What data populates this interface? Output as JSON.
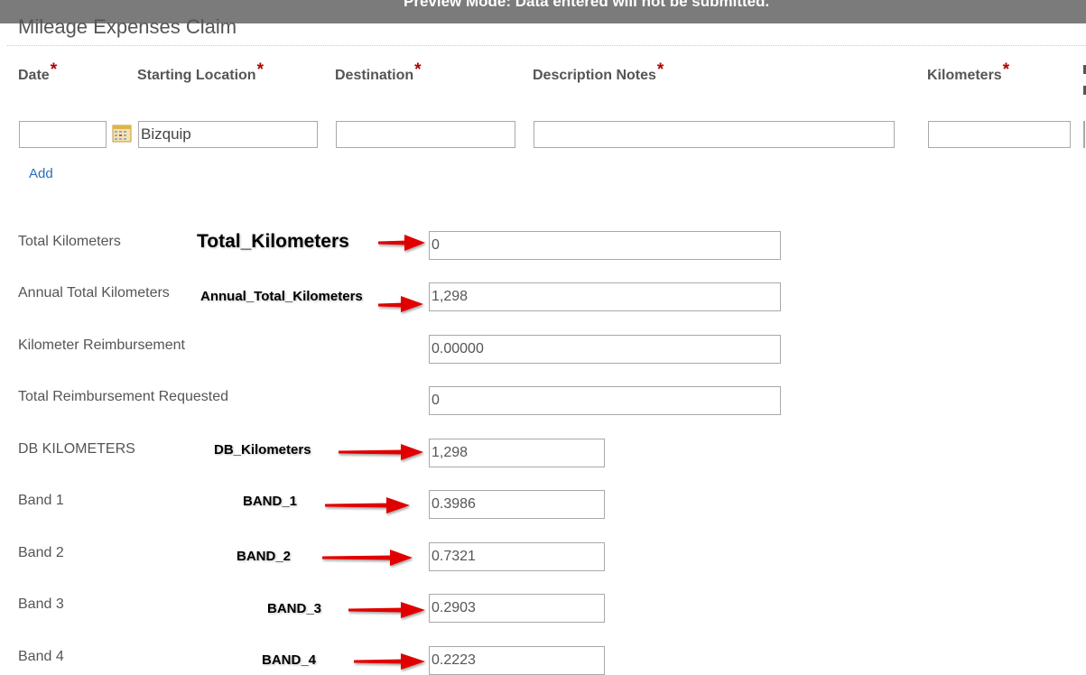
{
  "banner": {
    "text": "Preview Mode: Data entered will not be submitted."
  },
  "form": {
    "title": "Mileage Expenses Claim"
  },
  "grid": {
    "required_mark": "*",
    "columns": {
      "date": "Date",
      "starting_location": "Starting Location",
      "destination": "Destination",
      "description": "Description Notes",
      "kilometers": "Kilometers"
    },
    "row": {
      "date": "",
      "starting_location": "Bizquip",
      "destination": "",
      "description": "",
      "kilometers": ""
    },
    "add_label": "Add"
  },
  "fields": {
    "total_km": {
      "label": "Total Kilometers",
      "value": "0"
    },
    "annual_total_km": {
      "label": "Annual Total Kilometers",
      "value": "1,298"
    },
    "km_reimbursement": {
      "label": "Kilometer Reimbursement",
      "value": "0.00000"
    },
    "total_reimbursement": {
      "label": "Total Reimbursement Requested",
      "value": "0"
    },
    "db_km": {
      "label": "DB KILOMETERS",
      "value": "1,298"
    },
    "band1": {
      "label": "Band 1",
      "value": "0.3986"
    },
    "band2": {
      "label": "Band 2",
      "value": "0.7321"
    },
    "band3": {
      "label": "Band 3",
      "value": "0.2903"
    },
    "band4": {
      "label": "Band 4",
      "value": "0.2223"
    }
  },
  "annotations": {
    "total_km": "Total_Kilometers",
    "annual_total_km": "Annual_Total_Kilometers",
    "db_km": "DB_Kilometers",
    "band1": "BAND_1",
    "band2": "BAND_2",
    "band3": "BAND_3",
    "band4": "BAND_4"
  },
  "colors": {
    "banner_bg": "#7b7b7b",
    "required": "#b00000",
    "link": "#2a6ebb",
    "arrow": "#e00000"
  },
  "icons": {
    "date_picker": "calendar-icon"
  }
}
